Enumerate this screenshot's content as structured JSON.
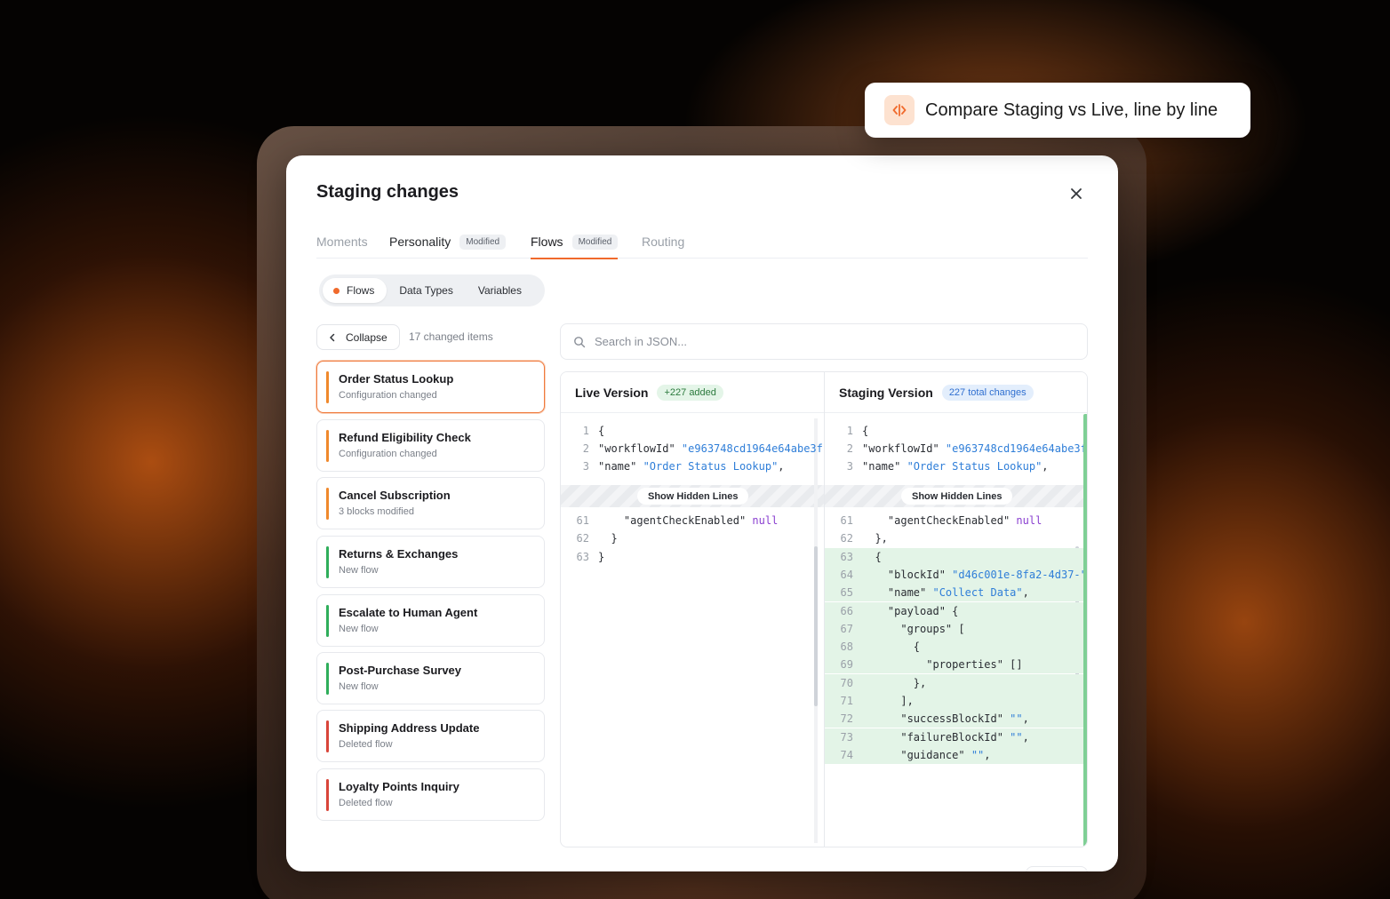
{
  "callout": {
    "text": "Compare Staging vs Live, line by line",
    "icon": "code-compare-icon"
  },
  "panel": {
    "title": "Staging changes",
    "close_icon": "close-icon",
    "tabs": [
      {
        "label": "Moments",
        "badge": ""
      },
      {
        "label": "Personality",
        "badge": "Modified"
      },
      {
        "label": "Flows",
        "badge": "Modified"
      },
      {
        "label": "Routing",
        "badge": ""
      }
    ],
    "segments": [
      "Flows",
      "Data Types",
      "Variables"
    ],
    "collapse_label": "Collapse",
    "changed_count": "17 changed items",
    "items": [
      {
        "name": "Order Status Lookup",
        "sub": "Configuration changed",
        "status": "modified"
      },
      {
        "name": "Refund Eligibility Check",
        "sub": "Configuration changed",
        "status": "modified"
      },
      {
        "name": "Cancel Subscription",
        "sub": "3 blocks modified",
        "status": "modified"
      },
      {
        "name": "Returns & Exchanges",
        "sub": "New flow",
        "status": "new"
      },
      {
        "name": "Escalate to Human Agent",
        "sub": "New flow",
        "status": "new"
      },
      {
        "name": "Post-Purchase Survey",
        "sub": "New flow",
        "status": "new"
      },
      {
        "name": "Shipping Address Update",
        "sub": "Deleted flow",
        "status": "deleted"
      },
      {
        "name": "Loyalty Points Inquiry",
        "sub": "Deleted flow",
        "status": "deleted"
      }
    ],
    "search_placeholder": "Search in JSON...",
    "live": {
      "title": "Live Version",
      "pill": "+227 added",
      "show_hidden": "Show Hidden Lines",
      "top_lines": [
        {
          "n": "1",
          "parts": [
            [
              "p",
              "{"
            ]
          ]
        },
        {
          "n": "2",
          "parts": [
            [
              "p",
              "\"workflowId\" "
            ],
            [
              "s",
              "\"e963748cd1964e64abe3f\""
            ]
          ]
        },
        {
          "n": "3",
          "parts": [
            [
              "p",
              "\"name\" "
            ],
            [
              "s",
              "\"Order Status Lookup\""
            ],
            [
              "p",
              ","
            ]
          ]
        }
      ],
      "bottom_lines": [
        {
          "n": "61",
          "parts": [
            [
              "p",
              "    \"agentCheckEnabled\" "
            ],
            [
              "k",
              "null"
            ]
          ]
        },
        {
          "n": "62",
          "parts": [
            [
              "p",
              "  }"
            ]
          ]
        },
        {
          "n": "63",
          "parts": [
            [
              "p",
              "}"
            ]
          ]
        }
      ]
    },
    "staging": {
      "title": "Staging Version",
      "pill": "227 total changes",
      "show_hidden": "Show Hidden Lines",
      "top_lines": [
        {
          "n": "1",
          "parts": [
            [
              "p",
              "{"
            ]
          ]
        },
        {
          "n": "2",
          "parts": [
            [
              "p",
              "\"workflowId\" "
            ],
            [
              "s",
              "\"e963748cd1964e64abe3f\""
            ]
          ]
        },
        {
          "n": "3",
          "parts": [
            [
              "p",
              "\"name\" "
            ],
            [
              "s",
              "\"Order Status Lookup\""
            ],
            [
              "p",
              ","
            ]
          ]
        }
      ],
      "bottom_lines": [
        {
          "n": "61",
          "added": false,
          "parts": [
            [
              "p",
              "    \"agentCheckEnabled\" "
            ],
            [
              "k",
              "null"
            ]
          ]
        },
        {
          "n": "62",
          "added": false,
          "parts": [
            [
              "p",
              "  },"
            ]
          ]
        },
        {
          "n": "63",
          "added": true,
          "parts": [
            [
              "p",
              "  {"
            ]
          ]
        },
        {
          "n": "64",
          "added": true,
          "parts": [
            [
              "p",
              "    \"blockId\" "
            ],
            [
              "s",
              "\"d46c001e-8fa2-4d37-\""
            ]
          ]
        },
        {
          "n": "65",
          "added": true,
          "parts": [
            [
              "p",
              "    \"name\" "
            ],
            [
              "s",
              "\"Collect Data\""
            ],
            [
              "p",
              ","
            ]
          ]
        },
        {
          "n": "66",
          "added": true,
          "parts": [
            [
              "p",
              "    \"payload\" {"
            ]
          ]
        },
        {
          "n": "67",
          "added": true,
          "parts": [
            [
              "p",
              "      \"groups\" ["
            ]
          ]
        },
        {
          "n": "68",
          "added": true,
          "parts": [
            [
              "p",
              "        {"
            ]
          ]
        },
        {
          "n": "69",
          "added": true,
          "parts": [
            [
              "p",
              "          \"properties\" []"
            ]
          ]
        },
        {
          "n": "70",
          "added": true,
          "parts": [
            [
              "p",
              "        },"
            ]
          ]
        },
        {
          "n": "71",
          "added": true,
          "parts": [
            [
              "p",
              "      ],"
            ]
          ]
        },
        {
          "n": "72",
          "added": true,
          "parts": [
            [
              "p",
              "      \"successBlockId\" "
            ],
            [
              "s",
              "\"\""
            ],
            [
              "p",
              ","
            ]
          ]
        },
        {
          "n": "73",
          "added": true,
          "parts": [
            [
              "p",
              "      \"failureBlockId\" "
            ],
            [
              "s",
              "\"\""
            ],
            [
              "p",
              ","
            ]
          ]
        },
        {
          "n": "74",
          "added": true,
          "parts": [
            [
              "p",
              "      \"guidance\" "
            ],
            [
              "s",
              "\"\""
            ],
            [
              "p",
              ","
            ]
          ]
        }
      ]
    }
  },
  "colors": {
    "accent": "#f06a2c",
    "modified": "#f0892c",
    "new": "#2fae5b",
    "deleted": "#d9453a"
  }
}
